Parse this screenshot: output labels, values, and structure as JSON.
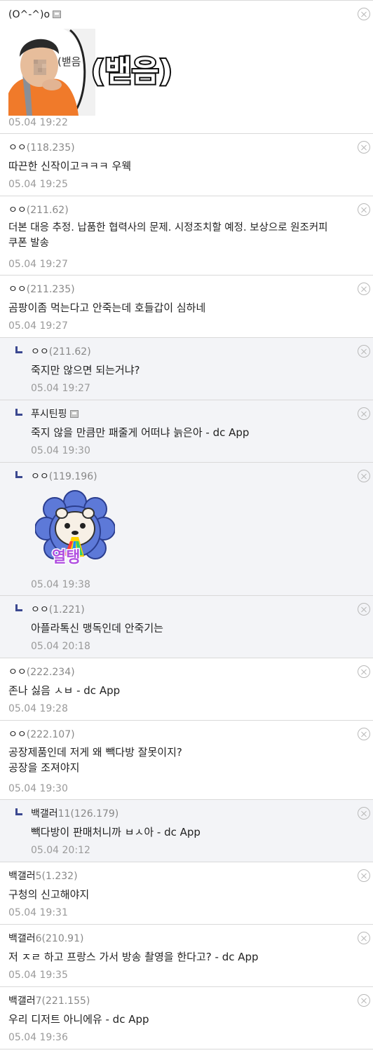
{
  "comments": [
    {
      "nick": "(O^-^)o",
      "ip": "",
      "memo": "",
      "time": "05.04 19:22"
    },
    {
      "nick": "ㅇㅇ",
      "ip": "(118.235)",
      "memo": "따끈한 신작이고ㅋㅋㅋ 우웩",
      "time": "05.04 19:25"
    },
    {
      "nick": "ㅇㅇ",
      "ip": "(211.62)",
      "memo": "더본 대응 추정. 납품한 협력사의 문제. 시정조치할 예정. 보상으로 원조커피",
      "memo2": "쿠폰 발송",
      "time": "05.04 19:27"
    },
    {
      "nick": "ㅇㅇ",
      "ip": "(211.235)",
      "memo": "곰팡이좀 먹는다고 안죽는데 호들갑이 심하네",
      "time": "05.04 19:27"
    },
    {
      "nick": "ㅇㅇ",
      "ip": "(211.62)",
      "memo": "죽지만 않으면 되는거냐?",
      "time": "05.04 19:27"
    },
    {
      "nick": "푸시틴핑",
      "ip": "",
      "memo": "죽지 않을 만큼만 패줄게 어떠냐 늙은아 - dc App",
      "time": "05.04 19:30"
    },
    {
      "nick": "ㅇㅇ",
      "ip": "(119.196)",
      "memo": "",
      "time": "05.04 19:38"
    },
    {
      "nick": "ㅇㅇ",
      "ip": "(1.221)",
      "memo": "아플라톡신 맹독인데 안죽기는",
      "time": "05.04 20:18"
    },
    {
      "nick": "ㅇㅇ",
      "ip": "(222.234)",
      "memo": "존나 싫음 ㅅㅂ - dc App",
      "time": "05.04 19:28"
    },
    {
      "nick": "ㅇㅇ",
      "ip": "(222.107)",
      "memo": "공장제품인데 저게 왜 빽다방 잘못이지?",
      "memo2": "공장을 조져야지",
      "time": "05.04 19:30"
    },
    {
      "nick": "백갤러",
      "ip": "11(126.179)",
      "memo": "빽다방이 판매처니까 ㅂㅅ아 - dc App",
      "time": "05.04 20:12"
    },
    {
      "nick": "백갤러",
      "ip": "5(1.232)",
      "memo": "구청의 신고해야지",
      "time": "05.04 19:31"
    },
    {
      "nick": "백갤러",
      "ip": "6(210.91)",
      "memo": "저 ㅈㄹ 하고 프랑스 가서 방송 촬영을 한다고? - dc App",
      "time": "05.04 19:35"
    },
    {
      "nick": "백갤러",
      "ip": "7(221.155)",
      "memo": "우리 디저트 아니에유 - dc App",
      "time": "05.04 19:36"
    }
  ],
  "dccon": {
    "baek_caption": "(밷음)",
    "baek_sign": "(밷음",
    "yeoltaeng_caption": "열탱"
  },
  "colors": {
    "reply_bg": "#f3f4f7",
    "border": "#d9d9d9",
    "ip": "#888888",
    "time": "#9a9a9a",
    "reply_arrow": "#3b4890"
  },
  "icons": {
    "delete": "circle-x-icon",
    "fixed_nick": "fixed-nick-icon",
    "reply": "reply-arrow-icon"
  }
}
